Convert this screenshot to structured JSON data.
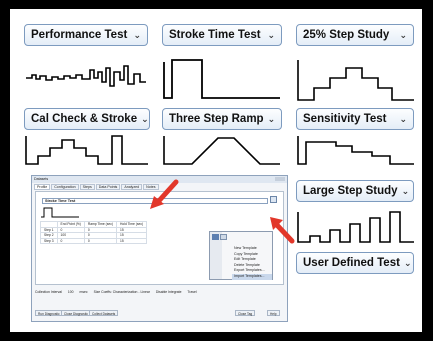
{
  "tests": [
    {
      "label": "Performance Test"
    },
    {
      "label": "Stroke Time Test"
    },
    {
      "label": "25% Step Study"
    },
    {
      "label": "Cal Check & Stroke"
    },
    {
      "label": "Three Step Ramp"
    },
    {
      "label": "Sensitivity Test"
    },
    {
      "label": "Large Step Study"
    },
    {
      "label": "User Defined Test"
    }
  ],
  "window": {
    "title": "Datasets",
    "tabs": [
      "Profile",
      "Configuration",
      "Steps",
      "Data Points",
      "Analyzed",
      "Notes"
    ],
    "selected_test": "Stroke Time Test",
    "table_headers": [
      "",
      "End Point (%)",
      "Ramp Time (sec)",
      "Hold Time (sec)"
    ],
    "table_rows": [
      [
        "Step 1",
        "0",
        "0",
        "15"
      ],
      [
        "Step 2",
        "100",
        "0",
        "15"
      ],
      [
        "Step 3",
        "0",
        "0",
        "15"
      ]
    ],
    "context_menu": [
      "New Template",
      "Copy Template",
      "Edit Template",
      "Delete Template",
      "Export Templates...",
      "Import Templates..."
    ],
    "status_items": [
      "Collection Interval",
      "100",
      "msec",
      "Size Coeffs: Characterization - Linear",
      "Disable Integrate",
      "Travel"
    ],
    "bottom_buttons": [
      "Run Diagnostic",
      "Close Diagnostic",
      "Collect Datasets",
      "Close Tag",
      "Help"
    ]
  },
  "icons": {
    "dropdown": "chevron-down-icon",
    "add_template": "add-template-icon",
    "arrow": "red-arrow-icon"
  },
  "colors": {
    "accent_arrow": "#e2372a",
    "pill_border": "#7d9bbf",
    "context_highlight": "#c9d8ec"
  }
}
